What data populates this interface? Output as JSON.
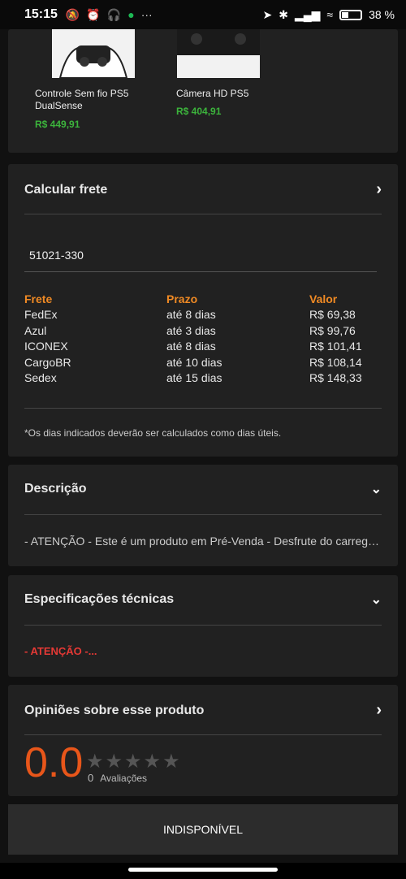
{
  "status": {
    "time": "15:15",
    "battery": "38 %"
  },
  "products": [
    {
      "name": "Controle Sem fio PS5 DualSense",
      "price": "R$ 449,91"
    },
    {
      "name": "Câmera HD PS5",
      "price": "R$ 404,91"
    }
  ],
  "frete": {
    "title": "Calcular frete",
    "cep": "51021-330",
    "headers": [
      "Frete",
      "Prazo",
      "Valor"
    ],
    "rows": [
      [
        "FedEx",
        "até 8 dias",
        "R$ 69,38"
      ],
      [
        "Azul",
        "até 3 dias",
        "R$ 99,76"
      ],
      [
        "ICONEX",
        "até 8 dias",
        "R$ 101,41"
      ],
      [
        "CargoBR",
        "até 10 dias",
        "R$ 108,14"
      ],
      [
        "Sedex",
        "até 15 dias",
        "R$ 148,33"
      ]
    ],
    "note": "*Os dias indicados deverão ser calculados como dias úteis."
  },
  "descricao": {
    "title": "Descrição",
    "text": "- ATENÇÃO - Este é um produto em Pré-Venda - Desfrute do carregamento"
  },
  "especificacoes": {
    "title": "Especificações técnicas",
    "text": "- ATENÇÃO -..."
  },
  "opinioes": {
    "title": "Opiniões sobre esse produto",
    "score": "0.0",
    "count": "0",
    "count_label": "Avaliações"
  },
  "action": {
    "label": "INDISPONÍVEL"
  },
  "colors": {
    "accent": "#f08a24",
    "price": "#3cb43c",
    "score": "#e8561a",
    "alert": "#e53935"
  }
}
